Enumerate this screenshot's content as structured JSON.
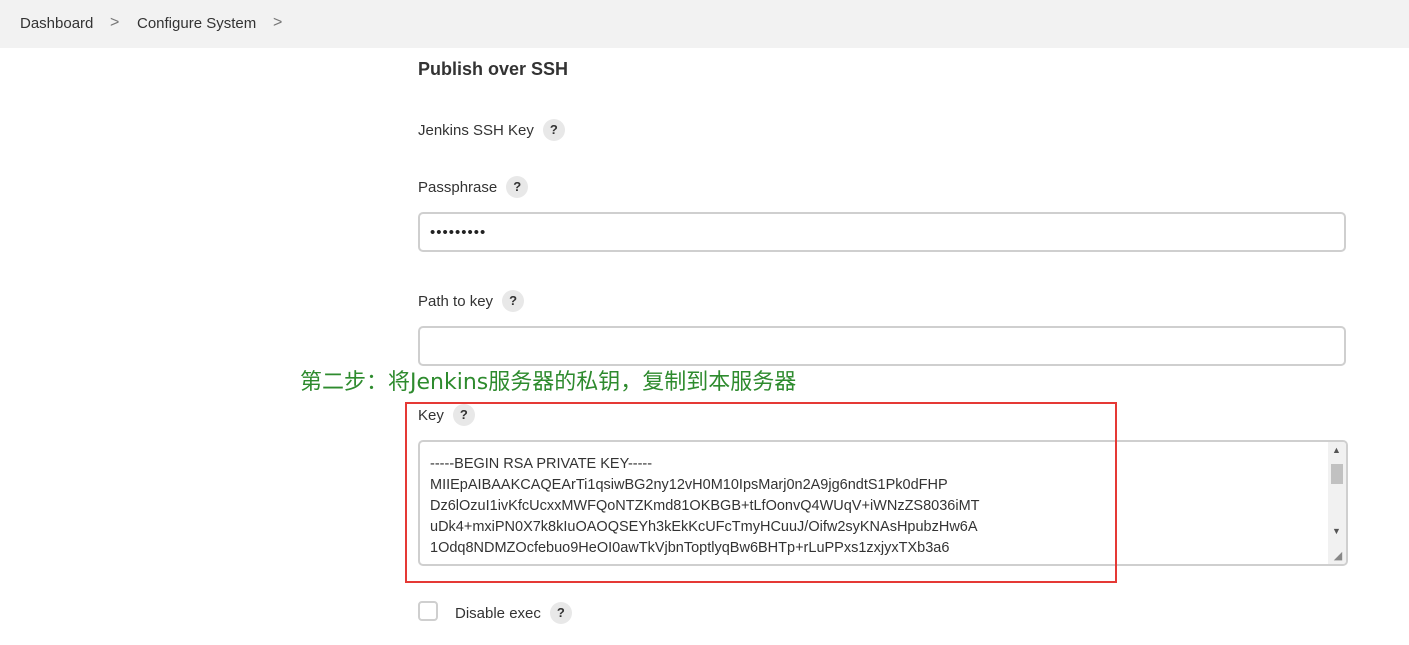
{
  "breadcrumb": {
    "items": [
      "Dashboard",
      "Configure System"
    ],
    "separator": ">"
  },
  "section": {
    "title": "Publish over SSH"
  },
  "fields": {
    "jenkins_ssh_key_label": "Jenkins SSH Key",
    "passphrase_label": "Passphrase",
    "passphrase_value": "•••••••••",
    "path_to_key_label": "Path to key",
    "path_to_key_value": "",
    "key_label": "Key",
    "key_value": "-----BEGIN RSA PRIVATE KEY-----\nMIIEpAIBAAKCAQEArTi1qsiwBG2ny12vH0M10IpsMarj0n2A9jg6ndtS1Pk0dFHP\nDz6lOzuI1ivKfcUcxxMWFQoNTZKmd81OKBGB+tLfOonvQ4WUqV+iWNzZS8036iMT\nuDk4+mxiPN0X7k8kIuOAOQSEYh3kEkKcUFcTmyHCuuJ/Oifw2syKNAsHpubzHw6A\n1Odq8NDMZOcfebuo9HeOI0awTkVjbnToptlyqBw6BHTp+rLuPPxs1zxjyxTXb3a6",
    "disable_exec_label": "Disable exec"
  },
  "help_glyph": "?",
  "annotation": {
    "text": "第二步：将Jenkins服务器的私钥，复制到本服务器",
    "color": "#2e8b2e"
  },
  "highlight_color": "#e53935",
  "icons": {
    "scroll_up": "▲",
    "scroll_down": "▼",
    "resize": "◢"
  }
}
